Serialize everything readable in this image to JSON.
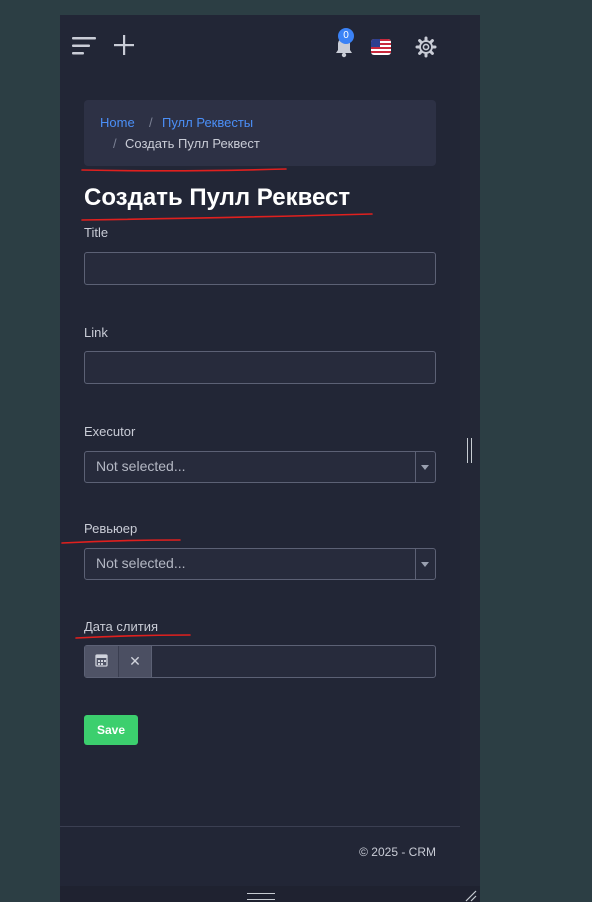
{
  "topbar": {
    "notifications_count": "0",
    "icons": [
      "hamburger-menu-icon",
      "plus-icon",
      "bell-icon",
      "us-flag-icon",
      "gear-icon"
    ]
  },
  "breadcrumb": {
    "home": "Home",
    "separator": "/",
    "pull_requests": "Пулл Реквесты",
    "current": "Создать Пулл Реквест"
  },
  "page_title": "Создать Пулл Реквест",
  "form": {
    "title_label": "Title",
    "title_value": "",
    "link_label": "Link",
    "link_value": "",
    "executor_label": "Executor",
    "executor_value": "Not selected...",
    "reviewer_label": "Ревьюер",
    "reviewer_value": "Not selected...",
    "merge_date_label": "Дата слития",
    "merge_date_value": "",
    "clear_symbol": "✕",
    "save_label": "Save"
  },
  "footer": {
    "text": "© 2025 - CRM"
  },
  "colors": {
    "background": "#2c3e44",
    "panel": "#222636",
    "link": "#4b8ff7",
    "accent_blue": "#3b82f6",
    "save_green": "#3ccf6e",
    "annotation_red": "#e0201e"
  }
}
